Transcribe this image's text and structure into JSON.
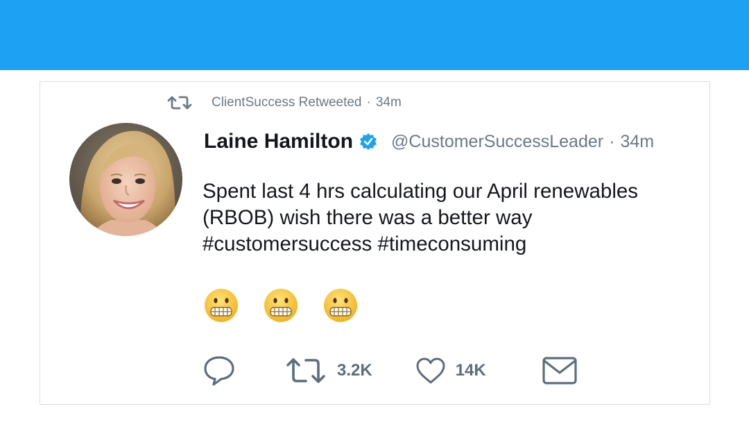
{
  "colors": {
    "top_bar": "#1DA1F2",
    "verified": "#1DA1F2",
    "muted_text": "#697987",
    "action_icons": "#5d6d7c"
  },
  "retweet_context": {
    "icon": "retweet-icon",
    "by": "ClientSuccess Retweeted",
    "separator": "·",
    "time": "34m"
  },
  "tweet": {
    "author_name": "Laine Hamilton",
    "verified_icon": "verified-badge-icon",
    "handle": "@CustomerSuccessLeader",
    "separator": "·",
    "time": "34m",
    "text_lines": [
      "Spent last 4 hrs calculating our April renewables",
      "(RBOB) wish there was a better way",
      "#customersuccess #timeconsuming"
    ],
    "emojis": [
      "grimacing-face",
      "grimacing-face",
      "grimacing-face"
    ]
  },
  "actions": {
    "reply_icon": "reply-icon",
    "retweet_icon": "retweet-icon",
    "retweet_count": "3.2K",
    "like_icon": "heart-icon",
    "like_count": "14K",
    "dm_icon": "envelope-icon"
  }
}
